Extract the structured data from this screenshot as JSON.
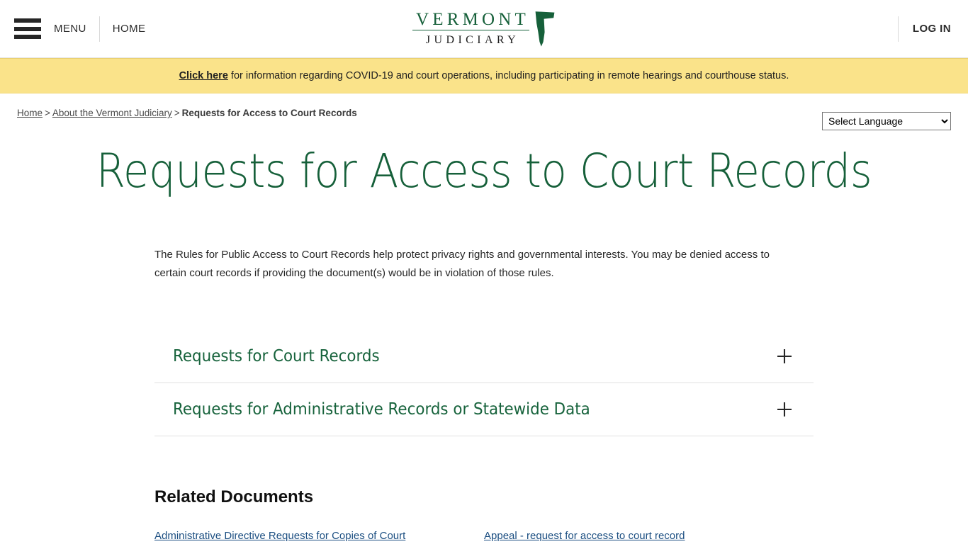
{
  "header": {
    "menu_label": "MENU",
    "home_label": "HOME",
    "login_label": "LOG IN",
    "logo": {
      "line1": "VERMONT",
      "line2": "JUDICIARY",
      "shape_icon": "vermont-state-icon",
      "green": "#16603a"
    },
    "hamburger_icon": "hamburger-menu-icon"
  },
  "alert": {
    "link_text": "Click here",
    "message": " for information regarding COVID-19 and court operations, including participating in remote hearings and courthouse status.",
    "background": "#fae38a"
  },
  "breadcrumb": {
    "items": [
      {
        "label": "Home",
        "link": true
      },
      {
        "label": "About the Vermont Judiciary",
        "link": true
      },
      {
        "label": "Requests for Access to Court Records",
        "link": false
      }
    ],
    "separator": ">"
  },
  "language": {
    "selected": "Select Language",
    "options": [
      "Select Language"
    ]
  },
  "main": {
    "title": "Requests for Access to Court Records",
    "intro": "The Rules for Public Access to Court Records help protect privacy rights and governmental interests. You may be denied access to certain court records if providing the document(s) would be in violation of those rules.",
    "accordion": [
      {
        "title": "Requests for Court Records",
        "expand_icon": "plus-icon"
      },
      {
        "title": "Requests for Administrative Records or Statewide Data",
        "expand_icon": "plus-icon"
      }
    ],
    "related": {
      "heading": "Related Documents",
      "links": [
        "Administrative Directive Requests for Copies of Court",
        "Appeal - request for access to court record"
      ]
    }
  }
}
